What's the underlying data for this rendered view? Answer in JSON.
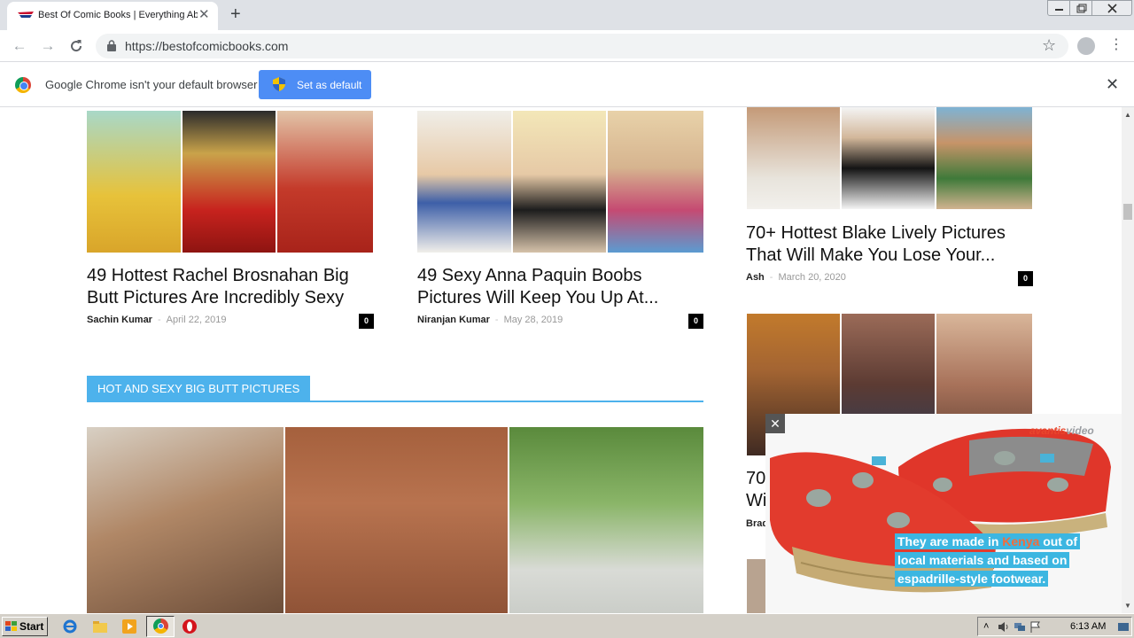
{
  "browser": {
    "tab_title": "Best Of Comic Books | Everything Ab",
    "tab_close": "✕",
    "new_tab": "+",
    "url": "https://bestofcomicbooks.com",
    "infobar_message": "Google Chrome isn't your default browser",
    "set_default_label": "Set as default",
    "infobar_close": "✕"
  },
  "articles_left": [
    {
      "title": "49 Hottest Rachel Brosnahan Big Butt Pictures Are Incredibly Sexy",
      "author": "Sachin Kumar",
      "date": "April 22, 2019",
      "comments": "0"
    },
    {
      "title": "49 Sexy Anna Paquin Boobs Pictures Will Keep You Up At...",
      "author": "Niranjan Kumar",
      "date": "May 28, 2019",
      "comments": "0"
    }
  ],
  "articles_right": [
    {
      "title": "70+ Hottest Blake Lively Pictures That Will Make You Lose Your...",
      "author": "Ash",
      "date": "March 20, 2020",
      "comments": "0"
    },
    {
      "title_partial_1": "70",
      "title_partial_2": "Wi",
      "author_partial": "Brad"
    }
  ],
  "section": {
    "heading": "HOT AND SEXY BIG BUTT PICTURES"
  },
  "ad": {
    "brand_a": "avantis",
    "brand_b": "video",
    "close": "✕",
    "caption_1a": "They are made in ",
    "caption_1b": "Kenya",
    "caption_1c": " out of",
    "caption_2": "local materials and based on",
    "caption_3": "espadrille-style footwear."
  },
  "taskbar": {
    "start_label": "Start",
    "clock": "6:13 AM"
  },
  "colors": {
    "accent_blue": "#4db2ec",
    "button_blue": "#4d8df5",
    "ad_orange": "#e8452c"
  }
}
